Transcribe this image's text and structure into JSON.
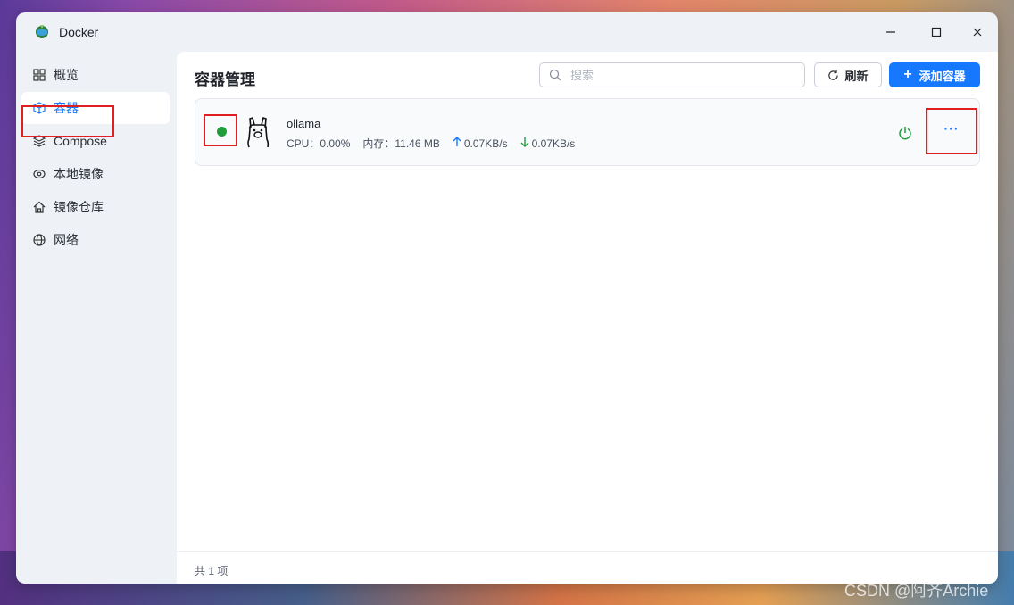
{
  "window": {
    "title": "Docker"
  },
  "sidebar": {
    "items": [
      {
        "label": "概览",
        "icon": "grid-icon"
      },
      {
        "label": "容器",
        "icon": "cube-icon",
        "active": true
      },
      {
        "label": "Compose",
        "icon": "layers-icon"
      },
      {
        "label": "本地镜像",
        "icon": "disk-icon"
      },
      {
        "label": "镜像仓库",
        "icon": "home-icon"
      },
      {
        "label": "网络",
        "icon": "globe-icon"
      }
    ]
  },
  "main": {
    "title": "容器管理",
    "search": {
      "placeholder": "搜索",
      "value": ""
    },
    "refresh_label": "刷新",
    "add_label": "添加容器",
    "containers": [
      {
        "name": "ollama",
        "status": "running",
        "status_color": "#1f9d3a",
        "cpu_label": "CPU：",
        "cpu": "0.00%",
        "mem_label": "内存：",
        "mem": "11.46 MB",
        "upload": "0.07KB/s",
        "download": "0.07KB/s",
        "more_label": "···"
      }
    ],
    "footer": "共 1 项"
  },
  "colors": {
    "accent": "#1677ff",
    "running": "#1f9d3a",
    "highlight": "#e02020"
  },
  "watermark": "CSDN @阿齐Archie"
}
